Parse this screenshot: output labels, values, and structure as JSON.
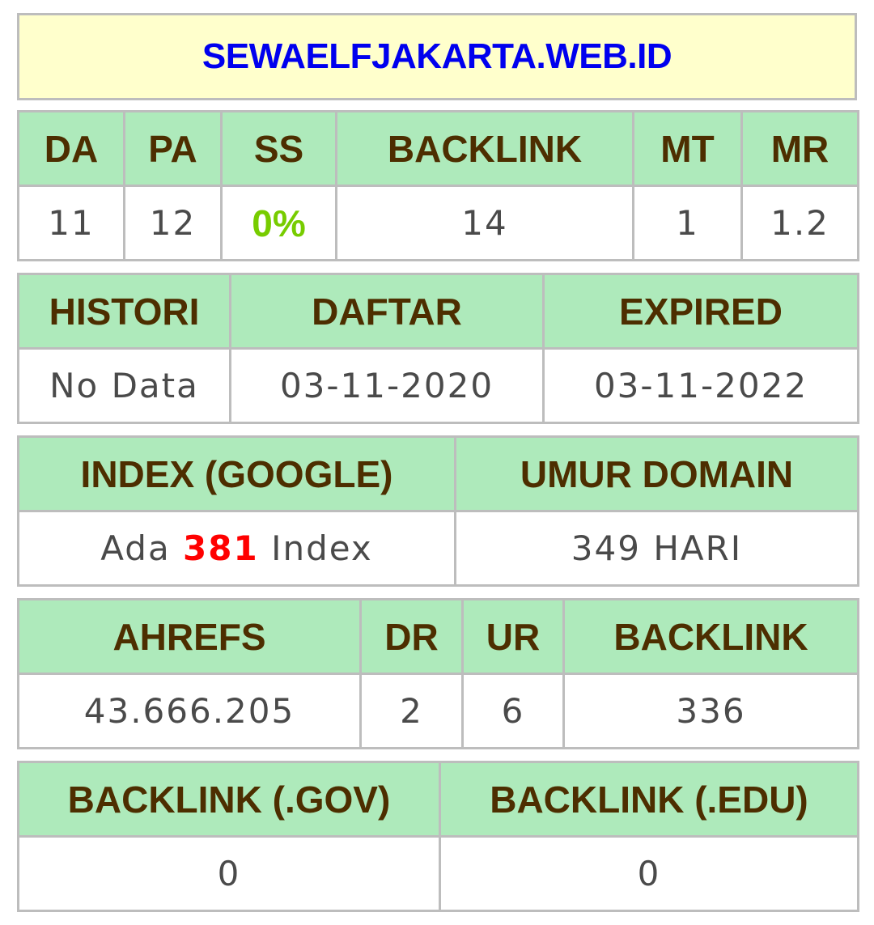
{
  "domain": "SEWAELFJAKARTA.WEB.ID",
  "metrics": {
    "headers": [
      "DA",
      "PA",
      "SS",
      "BACKLINK",
      "MT",
      "MR"
    ],
    "values": [
      "11",
      "12",
      "0%",
      "14",
      "1",
      "1.2"
    ]
  },
  "history": {
    "headers": [
      "HISTORI",
      "DAFTAR",
      "EXPIRED"
    ],
    "values": [
      "No Data",
      "03-11-2020",
      "03-11-2022"
    ]
  },
  "index": {
    "headers": [
      "INDEX (GOOGLE)",
      "UMUR DOMAIN"
    ],
    "index_prefix": "Ada",
    "index_count": "381",
    "index_suffix": "Index",
    "domain_age": "349 HARI"
  },
  "ahrefs": {
    "headers": [
      "AHREFS",
      "DR",
      "UR",
      "BACKLINK"
    ],
    "values": [
      "43.666.205",
      "2",
      "6",
      "336"
    ]
  },
  "edu_gov": {
    "headers": [
      "BACKLINK (.GOV)",
      "BACKLINK (.EDU)"
    ],
    "values": [
      "0",
      "0"
    ]
  },
  "colors": {
    "header_bg": "#aeeabb",
    "header_text": "#4d2e00",
    "title_bg": "#ffffcc",
    "title_text": "#0000ee",
    "ss_value": "#77cc00",
    "index_count": "#ff0000"
  }
}
